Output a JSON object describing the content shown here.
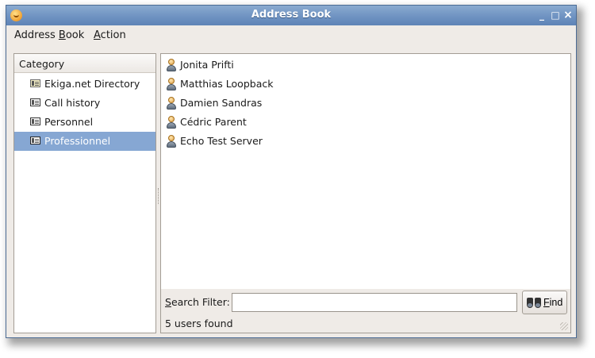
{
  "window": {
    "title": "Address Book",
    "controls": {
      "minimize": "_",
      "maximize": "□",
      "close": "×"
    }
  },
  "menubar": {
    "items": [
      {
        "label_pre": "Address ",
        "mnemonic": "B",
        "label_post": "ook"
      },
      {
        "label_pre": "",
        "mnemonic": "A",
        "label_post": "ction"
      }
    ]
  },
  "category_pane": {
    "header": "Category",
    "items": [
      {
        "label": "Ekiga.net Directory",
        "icon": "directory-icon",
        "selected": false
      },
      {
        "label": "Call history",
        "icon": "addressbook-icon",
        "selected": false
      },
      {
        "label": "Personnel",
        "icon": "addressbook-icon",
        "selected": false
      },
      {
        "label": "Professionnel",
        "icon": "addressbook-icon",
        "selected": true
      }
    ]
  },
  "contacts": {
    "items": [
      {
        "name": "Jonita Prifti",
        "icon": "user-icon"
      },
      {
        "name": "Matthias Loopback",
        "icon": "user-icon"
      },
      {
        "name": "Damien Sandras",
        "icon": "user-icon"
      },
      {
        "name": "Cédric Parent",
        "icon": "user-icon"
      },
      {
        "name": "Echo Test Server",
        "icon": "user-icon"
      }
    ]
  },
  "search": {
    "label_mnemonic": "S",
    "label_rest": "earch Filter:",
    "value": "",
    "placeholder": ""
  },
  "find_button": {
    "label_mnemonic": "F",
    "label_rest": "ind",
    "icon": "binoculars-icon"
  },
  "status": {
    "text": "5 users found"
  },
  "colors": {
    "titlebar": "#6f93c2",
    "selection": "#86a7d3",
    "window_bg": "#efebe7"
  }
}
